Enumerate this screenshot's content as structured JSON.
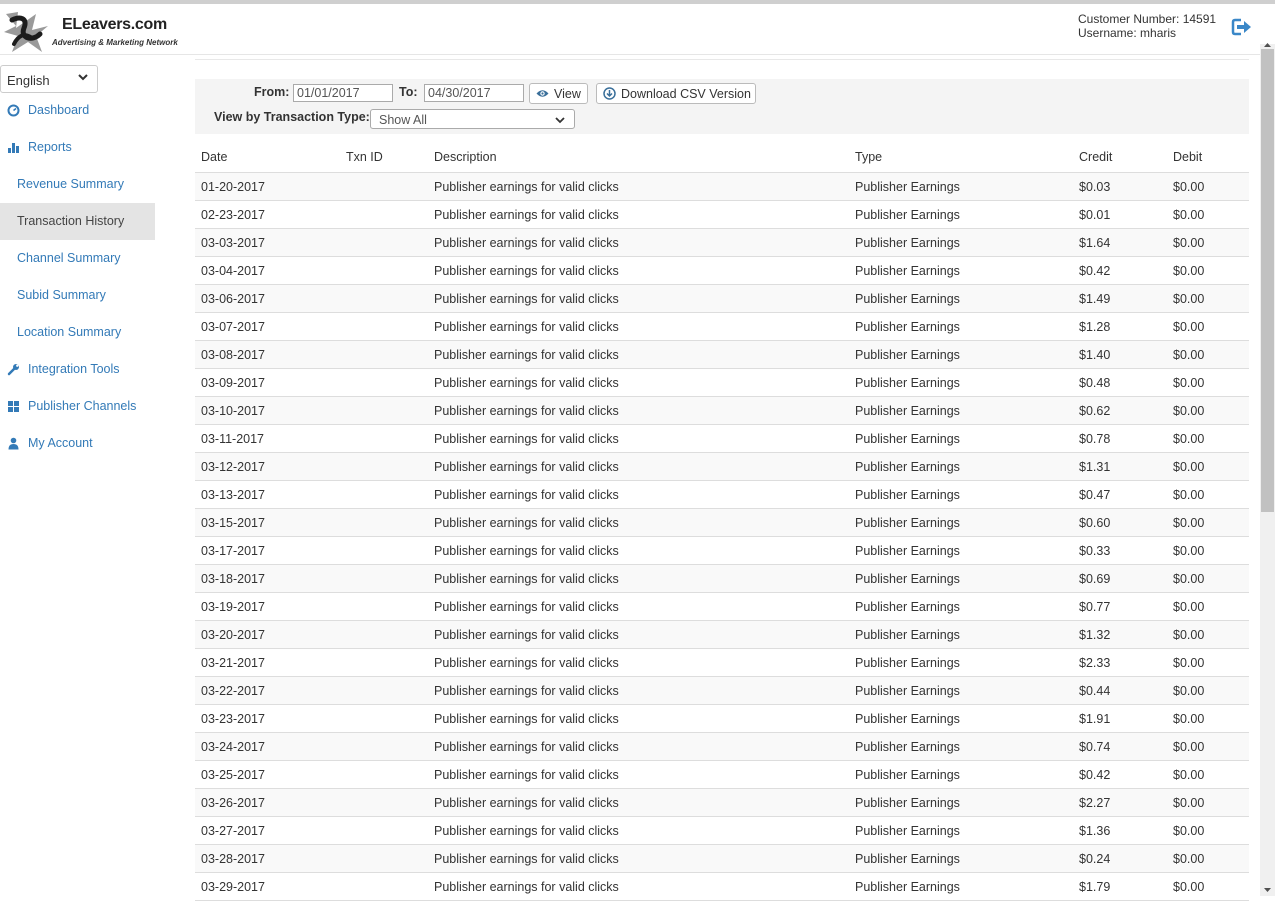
{
  "header": {
    "logo_title": "ELeavers.com",
    "logo_subtitle": "Advertising & Marketing Network",
    "customer_number": "Customer Number: 14591",
    "username": "Username: mharis"
  },
  "sidebar": {
    "language": "English",
    "items": [
      {
        "label": "Dashboard",
        "icon": "dashboard-icon"
      },
      {
        "label": "Reports",
        "icon": "bar-chart-icon"
      },
      {
        "label": "Revenue Summary"
      },
      {
        "label": "Transaction History",
        "active": true
      },
      {
        "label": "Channel Summary"
      },
      {
        "label": "Subid Summary"
      },
      {
        "label": "Location Summary"
      },
      {
        "label": "Integration Tools",
        "icon": "wrench-icon"
      },
      {
        "label": "Publisher Channels",
        "icon": "grid-icon"
      },
      {
        "label": "My Account",
        "icon": "user-icon"
      }
    ]
  },
  "filter": {
    "from_label": "From:",
    "from_value": "01/01/2017",
    "to_label": "To:",
    "to_value": "04/30/2017",
    "view_button": "View",
    "download_button": "Download CSV Version",
    "type_label": "View by Transaction Type:",
    "type_value": "Show All"
  },
  "table": {
    "headers": [
      "Date",
      "Txn ID",
      "Description",
      "Type",
      "Credit",
      "Debit"
    ],
    "rows": [
      [
        "01-20-2017",
        "",
        "Publisher earnings for valid clicks",
        "Publisher Earnings",
        "$0.03",
        "$0.00"
      ],
      [
        "02-23-2017",
        "",
        "Publisher earnings for valid clicks",
        "Publisher Earnings",
        "$0.01",
        "$0.00"
      ],
      [
        "03-03-2017",
        "",
        "Publisher earnings for valid clicks",
        "Publisher Earnings",
        "$1.64",
        "$0.00"
      ],
      [
        "03-04-2017",
        "",
        "Publisher earnings for valid clicks",
        "Publisher Earnings",
        "$0.42",
        "$0.00"
      ],
      [
        "03-06-2017",
        "",
        "Publisher earnings for valid clicks",
        "Publisher Earnings",
        "$1.49",
        "$0.00"
      ],
      [
        "03-07-2017",
        "",
        "Publisher earnings for valid clicks",
        "Publisher Earnings",
        "$1.28",
        "$0.00"
      ],
      [
        "03-08-2017",
        "",
        "Publisher earnings for valid clicks",
        "Publisher Earnings",
        "$1.40",
        "$0.00"
      ],
      [
        "03-09-2017",
        "",
        "Publisher earnings for valid clicks",
        "Publisher Earnings",
        "$0.48",
        "$0.00"
      ],
      [
        "03-10-2017",
        "",
        "Publisher earnings for valid clicks",
        "Publisher Earnings",
        "$0.62",
        "$0.00"
      ],
      [
        "03-11-2017",
        "",
        "Publisher earnings for valid clicks",
        "Publisher Earnings",
        "$0.78",
        "$0.00"
      ],
      [
        "03-12-2017",
        "",
        "Publisher earnings for valid clicks",
        "Publisher Earnings",
        "$1.31",
        "$0.00"
      ],
      [
        "03-13-2017",
        "",
        "Publisher earnings for valid clicks",
        "Publisher Earnings",
        "$0.47",
        "$0.00"
      ],
      [
        "03-15-2017",
        "",
        "Publisher earnings for valid clicks",
        "Publisher Earnings",
        "$0.60",
        "$0.00"
      ],
      [
        "03-17-2017",
        "",
        "Publisher earnings for valid clicks",
        "Publisher Earnings",
        "$0.33",
        "$0.00"
      ],
      [
        "03-18-2017",
        "",
        "Publisher earnings for valid clicks",
        "Publisher Earnings",
        "$0.69",
        "$0.00"
      ],
      [
        "03-19-2017",
        "",
        "Publisher earnings for valid clicks",
        "Publisher Earnings",
        "$0.77",
        "$0.00"
      ],
      [
        "03-20-2017",
        "",
        "Publisher earnings for valid clicks",
        "Publisher Earnings",
        "$1.32",
        "$0.00"
      ],
      [
        "03-21-2017",
        "",
        "Publisher earnings for valid clicks",
        "Publisher Earnings",
        "$2.33",
        "$0.00"
      ],
      [
        "03-22-2017",
        "",
        "Publisher earnings for valid clicks",
        "Publisher Earnings",
        "$0.44",
        "$0.00"
      ],
      [
        "03-23-2017",
        "",
        "Publisher earnings for valid clicks",
        "Publisher Earnings",
        "$1.91",
        "$0.00"
      ],
      [
        "03-24-2017",
        "",
        "Publisher earnings for valid clicks",
        "Publisher Earnings",
        "$0.74",
        "$0.00"
      ],
      [
        "03-25-2017",
        "",
        "Publisher earnings for valid clicks",
        "Publisher Earnings",
        "$0.42",
        "$0.00"
      ],
      [
        "03-26-2017",
        "",
        "Publisher earnings for valid clicks",
        "Publisher Earnings",
        "$2.27",
        "$0.00"
      ],
      [
        "03-27-2017",
        "",
        "Publisher earnings for valid clicks",
        "Publisher Earnings",
        "$1.36",
        "$0.00"
      ],
      [
        "03-28-2017",
        "",
        "Publisher earnings for valid clicks",
        "Publisher Earnings",
        "$0.24",
        "$0.00"
      ],
      [
        "03-29-2017",
        "",
        "Publisher earnings for valid clicks",
        "Publisher Earnings",
        "$1.79",
        "$0.00"
      ]
    ]
  },
  "colors": {
    "link": "#337ab7",
    "active_bg": "#e4e4e4",
    "filter_bg": "#f4f4f4"
  }
}
